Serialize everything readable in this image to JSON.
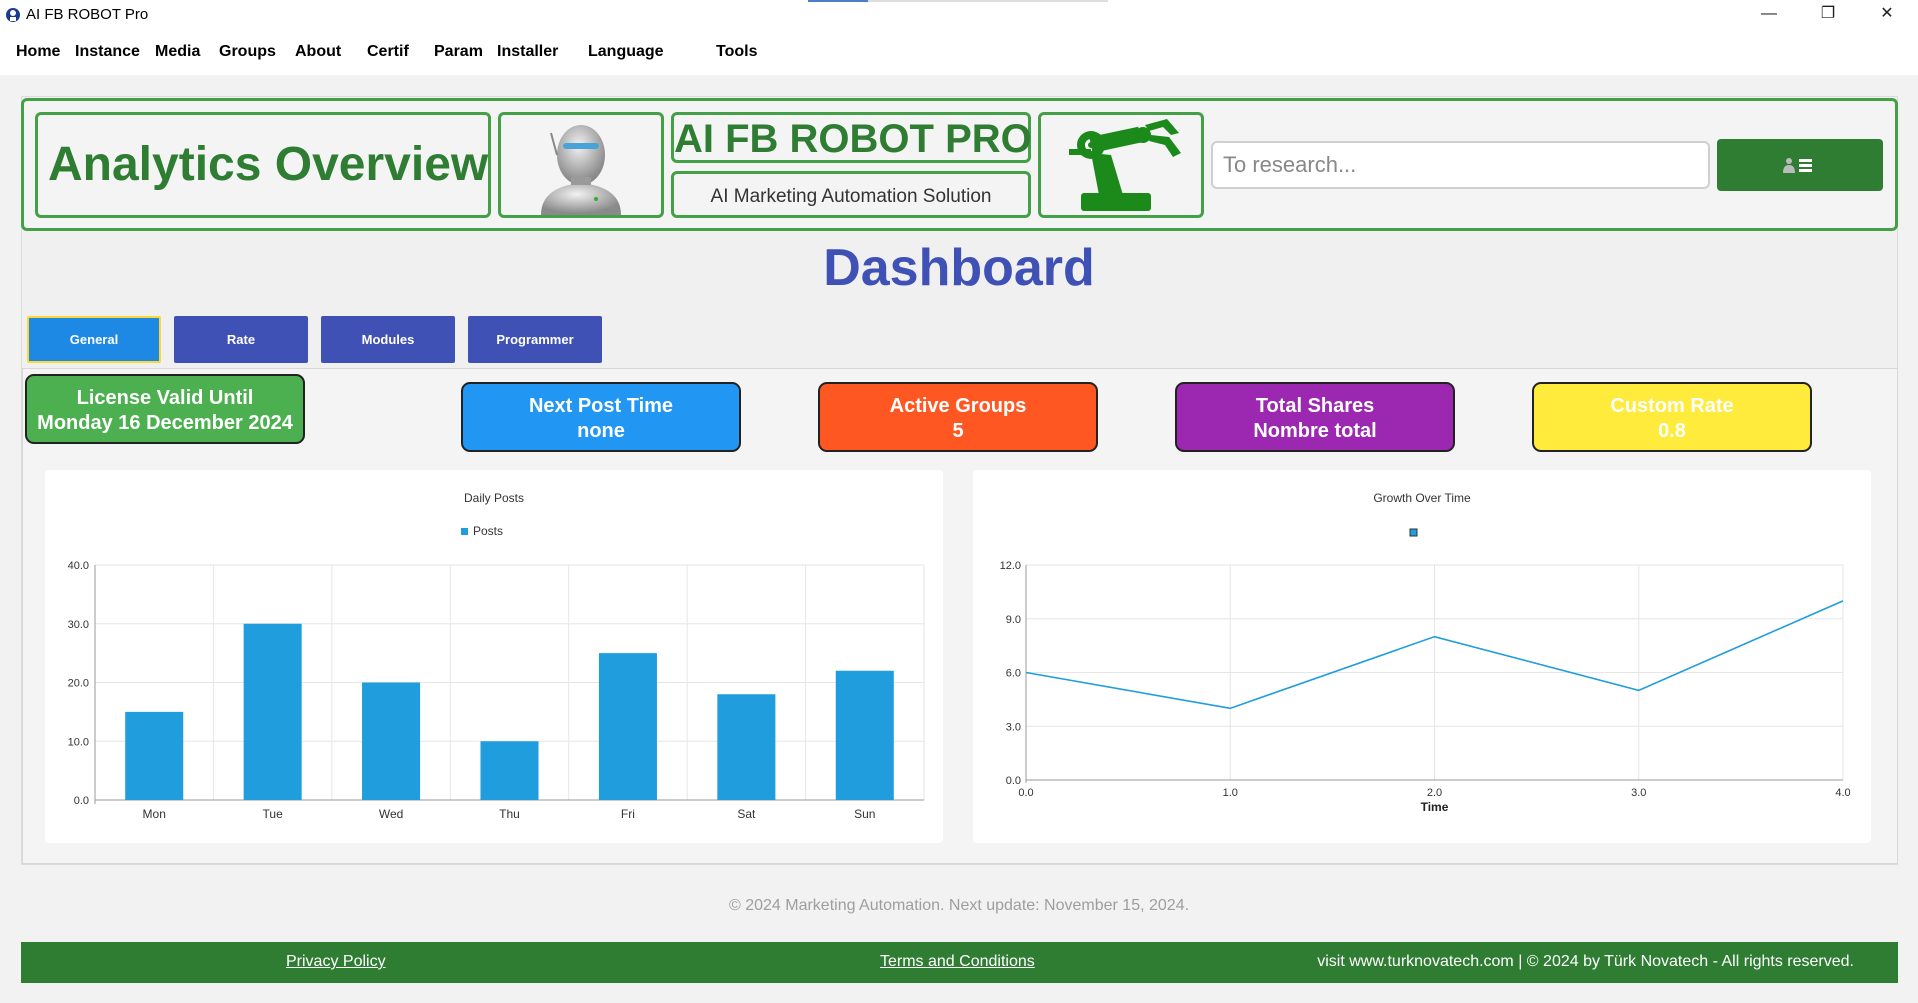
{
  "window": {
    "title": "AI FB ROBOT Pro",
    "minimize": "—",
    "restore": "❐",
    "close": "✕"
  },
  "menu": [
    "Home",
    "Instance",
    "Media",
    "Groups",
    "About",
    "Certif",
    "Param",
    "Installer",
    "Language",
    "Tools"
  ],
  "header": {
    "analytics_title": "Analytics Overview",
    "brand": "AI FB ROBOT PRO",
    "tagline": "AI Marketing Automation Solution",
    "search_placeholder": "To research...",
    "robot_icon": "robot-head-icon",
    "arm_icon": "robot-arm-icon",
    "menu_icon": "user-menu-icon"
  },
  "dashboard_title": "Dashboard",
  "tabs": [
    "General",
    "Rate",
    "Modules",
    "Programmer"
  ],
  "cards": {
    "license": {
      "line1": "License Valid Until",
      "line2": "Monday 16 December 2024"
    },
    "next_post": {
      "line1": "Next Post Time",
      "line2": "none"
    },
    "active_groups": {
      "line1": "Active Groups",
      "line2": "5"
    },
    "total_shares": {
      "line1": "Total Shares",
      "line2": "Nombre total"
    },
    "custom_rate": {
      "line1": "Custom Rate",
      "line2": "0.8"
    }
  },
  "colors": {
    "brand_green": "#2e7d32",
    "border_green": "#43a047",
    "tab_blue": "#3f51b5",
    "tab_active": "#1e88e5",
    "license": "#4caf50",
    "next_post": "#2196f3",
    "active_groups": "#ff5722",
    "total_shares": "#9c27b0",
    "custom_rate": "#ffeb3b",
    "series": "#1f9ddd"
  },
  "chart_data": [
    {
      "type": "bar",
      "title": "Daily Posts",
      "categories": [
        "Mon",
        "Tue",
        "Wed",
        "Thu",
        "Fri",
        "Sat",
        "Sun"
      ],
      "series": [
        {
          "name": "Posts",
          "values": [
            15,
            30,
            20,
            10,
            25,
            18,
            22
          ]
        }
      ],
      "ylim": [
        0,
        40
      ],
      "yticks": [
        "0.0",
        "10.0",
        "20.0",
        "30.0",
        "40.0"
      ],
      "xlabel": "",
      "ylabel": "",
      "legend": "top-center",
      "grid": true
    },
    {
      "type": "line",
      "title": "Growth Over Time",
      "x": [
        0,
        1,
        2,
        3,
        4
      ],
      "series": [
        {
          "values": [
            6,
            4,
            8,
            5,
            10
          ]
        }
      ],
      "xlim": [
        0,
        4
      ],
      "ylim": [
        0,
        12
      ],
      "xticks": [
        "0.0",
        "1.0",
        "2.0",
        "3.0",
        "4.0"
      ],
      "yticks": [
        "0.0",
        "3.0",
        "6.0",
        "9.0",
        "12.0"
      ],
      "xlabel": "Time",
      "ylabel": "",
      "legend": "top-center",
      "grid": true
    }
  ],
  "footer": {
    "note": "© 2024 Marketing Automation. Next update: November 15, 2024.",
    "privacy": "Privacy Policy",
    "terms": "Terms and Conditions",
    "rights": "visit www.turknovatech.com | © 2024 by Türk Novatech - All rights reserved."
  }
}
